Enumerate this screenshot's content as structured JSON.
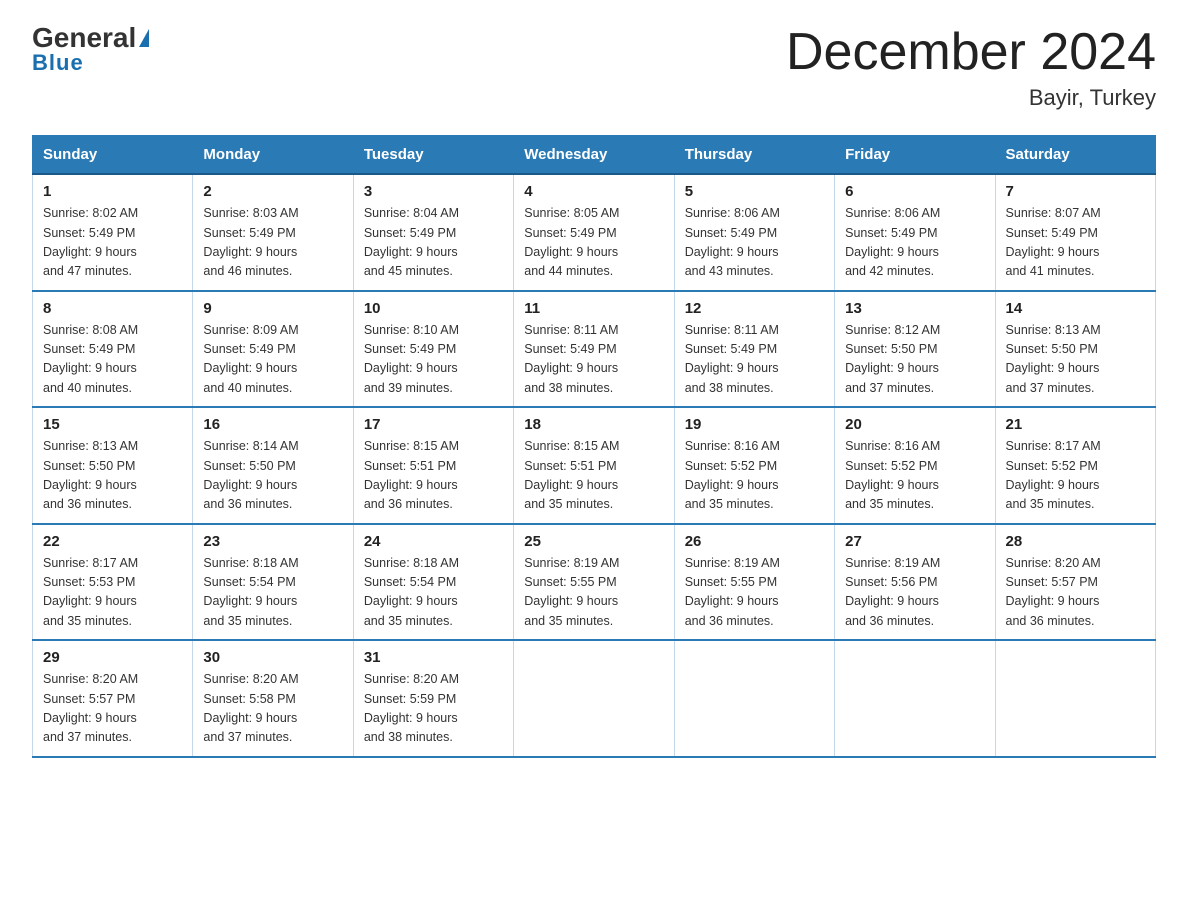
{
  "logo": {
    "general": "General",
    "triangle": "▶",
    "blue": "Blue"
  },
  "title": "December 2024",
  "subtitle": "Bayir, Turkey",
  "days_of_week": [
    "Sunday",
    "Monday",
    "Tuesday",
    "Wednesday",
    "Thursday",
    "Friday",
    "Saturday"
  ],
  "weeks": [
    [
      {
        "num": "1",
        "sunrise": "8:02 AM",
        "sunset": "5:49 PM",
        "daylight": "9 hours and 47 minutes."
      },
      {
        "num": "2",
        "sunrise": "8:03 AM",
        "sunset": "5:49 PM",
        "daylight": "9 hours and 46 minutes."
      },
      {
        "num": "3",
        "sunrise": "8:04 AM",
        "sunset": "5:49 PM",
        "daylight": "9 hours and 45 minutes."
      },
      {
        "num": "4",
        "sunrise": "8:05 AM",
        "sunset": "5:49 PM",
        "daylight": "9 hours and 44 minutes."
      },
      {
        "num": "5",
        "sunrise": "8:06 AM",
        "sunset": "5:49 PM",
        "daylight": "9 hours and 43 minutes."
      },
      {
        "num": "6",
        "sunrise": "8:06 AM",
        "sunset": "5:49 PM",
        "daylight": "9 hours and 42 minutes."
      },
      {
        "num": "7",
        "sunrise": "8:07 AM",
        "sunset": "5:49 PM",
        "daylight": "9 hours and 41 minutes."
      }
    ],
    [
      {
        "num": "8",
        "sunrise": "8:08 AM",
        "sunset": "5:49 PM",
        "daylight": "9 hours and 40 minutes."
      },
      {
        "num": "9",
        "sunrise": "8:09 AM",
        "sunset": "5:49 PM",
        "daylight": "9 hours and 40 minutes."
      },
      {
        "num": "10",
        "sunrise": "8:10 AM",
        "sunset": "5:49 PM",
        "daylight": "9 hours and 39 minutes."
      },
      {
        "num": "11",
        "sunrise": "8:11 AM",
        "sunset": "5:49 PM",
        "daylight": "9 hours and 38 minutes."
      },
      {
        "num": "12",
        "sunrise": "8:11 AM",
        "sunset": "5:49 PM",
        "daylight": "9 hours and 38 minutes."
      },
      {
        "num": "13",
        "sunrise": "8:12 AM",
        "sunset": "5:50 PM",
        "daylight": "9 hours and 37 minutes."
      },
      {
        "num": "14",
        "sunrise": "8:13 AM",
        "sunset": "5:50 PM",
        "daylight": "9 hours and 37 minutes."
      }
    ],
    [
      {
        "num": "15",
        "sunrise": "8:13 AM",
        "sunset": "5:50 PM",
        "daylight": "9 hours and 36 minutes."
      },
      {
        "num": "16",
        "sunrise": "8:14 AM",
        "sunset": "5:50 PM",
        "daylight": "9 hours and 36 minutes."
      },
      {
        "num": "17",
        "sunrise": "8:15 AM",
        "sunset": "5:51 PM",
        "daylight": "9 hours and 36 minutes."
      },
      {
        "num": "18",
        "sunrise": "8:15 AM",
        "sunset": "5:51 PM",
        "daylight": "9 hours and 35 minutes."
      },
      {
        "num": "19",
        "sunrise": "8:16 AM",
        "sunset": "5:52 PM",
        "daylight": "9 hours and 35 minutes."
      },
      {
        "num": "20",
        "sunrise": "8:16 AM",
        "sunset": "5:52 PM",
        "daylight": "9 hours and 35 minutes."
      },
      {
        "num": "21",
        "sunrise": "8:17 AM",
        "sunset": "5:52 PM",
        "daylight": "9 hours and 35 minutes."
      }
    ],
    [
      {
        "num": "22",
        "sunrise": "8:17 AM",
        "sunset": "5:53 PM",
        "daylight": "9 hours and 35 minutes."
      },
      {
        "num": "23",
        "sunrise": "8:18 AM",
        "sunset": "5:54 PM",
        "daylight": "9 hours and 35 minutes."
      },
      {
        "num": "24",
        "sunrise": "8:18 AM",
        "sunset": "5:54 PM",
        "daylight": "9 hours and 35 minutes."
      },
      {
        "num": "25",
        "sunrise": "8:19 AM",
        "sunset": "5:55 PM",
        "daylight": "9 hours and 35 minutes."
      },
      {
        "num": "26",
        "sunrise": "8:19 AM",
        "sunset": "5:55 PM",
        "daylight": "9 hours and 36 minutes."
      },
      {
        "num": "27",
        "sunrise": "8:19 AM",
        "sunset": "5:56 PM",
        "daylight": "9 hours and 36 minutes."
      },
      {
        "num": "28",
        "sunrise": "8:20 AM",
        "sunset": "5:57 PM",
        "daylight": "9 hours and 36 minutes."
      }
    ],
    [
      {
        "num": "29",
        "sunrise": "8:20 AM",
        "sunset": "5:57 PM",
        "daylight": "9 hours and 37 minutes."
      },
      {
        "num": "30",
        "sunrise": "8:20 AM",
        "sunset": "5:58 PM",
        "daylight": "9 hours and 37 minutes."
      },
      {
        "num": "31",
        "sunrise": "8:20 AM",
        "sunset": "5:59 PM",
        "daylight": "9 hours and 38 minutes."
      },
      null,
      null,
      null,
      null
    ]
  ],
  "labels": {
    "sunrise": "Sunrise:",
    "sunset": "Sunset:",
    "daylight": "Daylight:"
  }
}
